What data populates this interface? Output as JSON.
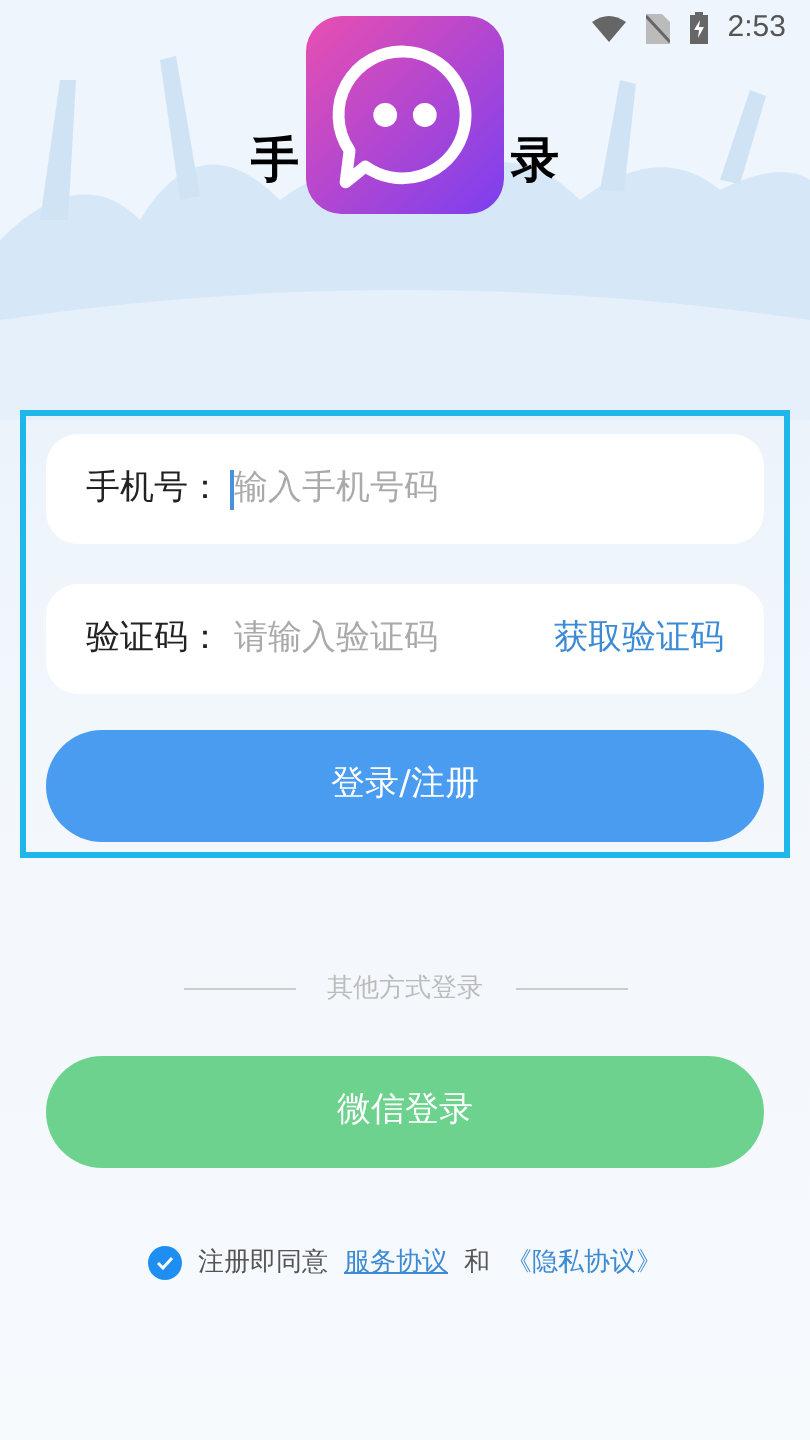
{
  "status_bar": {
    "time": "2:53"
  },
  "title": {
    "left": "手",
    "right": "录"
  },
  "form": {
    "fields": [
      {
        "label": "手机号：",
        "placeholder": "输入手机号码",
        "focused": true
      },
      {
        "label": "验证码：",
        "placeholder": "请输入验证码",
        "focused": false,
        "action": "获取验证码"
      }
    ],
    "submit": "登录/注册"
  },
  "alt_login": {
    "divider": "其他方式登录",
    "button": "微信登录"
  },
  "agreement": {
    "checked": true,
    "text": "注册即同意",
    "links": [
      {
        "text": "服务协议",
        "underlined": true
      },
      {
        "kind": "conjunction",
        "text": "和"
      },
      {
        "text": "《隐私协议》",
        "underlined": false
      }
    ]
  }
}
